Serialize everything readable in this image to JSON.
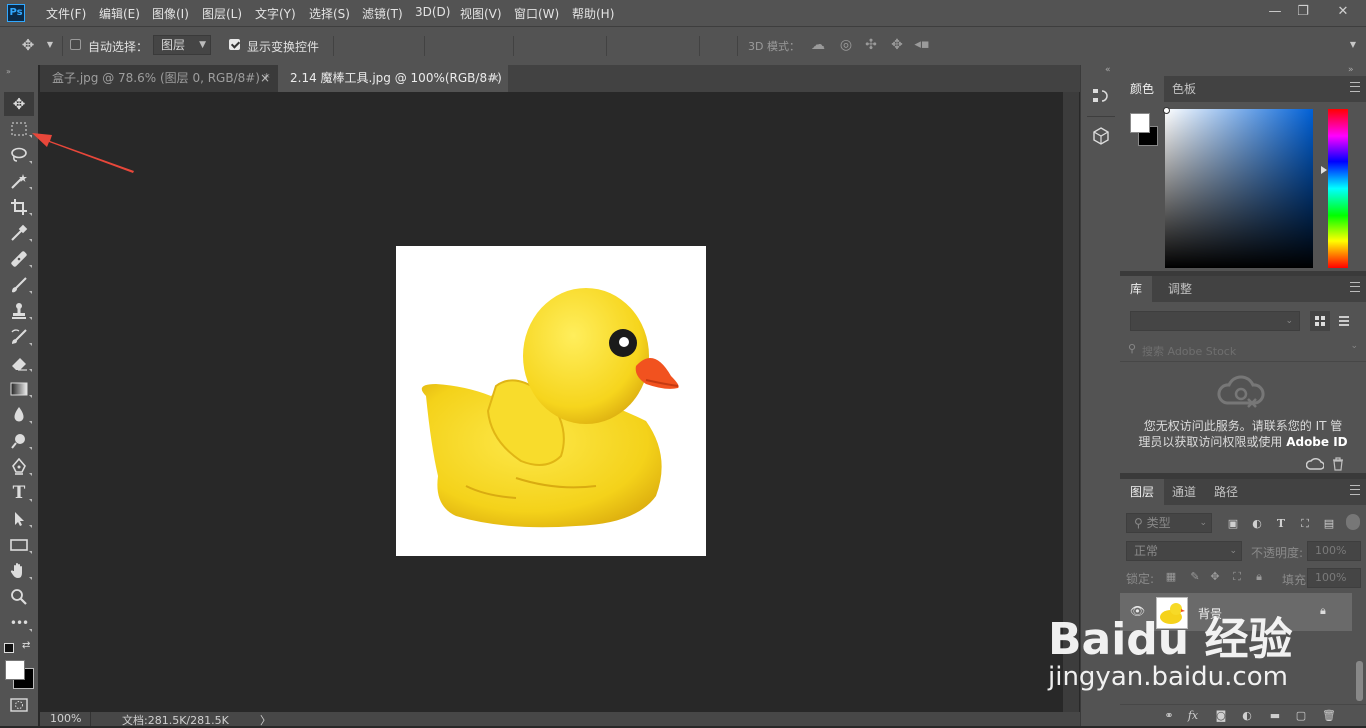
{
  "app": {
    "logo": "Ps"
  },
  "menu": [
    "文件(F)",
    "编辑(E)",
    "图像(I)",
    "图层(L)",
    "文字(Y)",
    "选择(S)",
    "滤镜(T)",
    "3D(D)",
    "视图(V)",
    "窗口(W)",
    "帮助(H)"
  ],
  "window_controls": {
    "minimize": "—",
    "restore": "❐",
    "close": "✕"
  },
  "options": {
    "auto_select_label": "自动选择：",
    "auto_select_target": "图层",
    "show_transform_label": "显示变换控件",
    "mode3d_label": "3D 模式："
  },
  "tabs": [
    {
      "label": "盒子.jpg @ 78.6% (图层 0, RGB/8#) *",
      "close": "×"
    },
    {
      "label": "2.14 魔棒工具.jpg @ 100%(RGB/8#)",
      "close": "×"
    }
  ],
  "tools": [
    "move-icon",
    "marquee-icon",
    "lasso-icon",
    "magic-wand-icon",
    "crop-icon",
    "eyedropper-icon",
    "healing-brush-icon",
    "brush-icon",
    "stamp-icon",
    "history-brush-icon",
    "eraser-icon",
    "gradient-icon",
    "blur-icon",
    "dodge-icon",
    "pen-icon",
    "type-icon",
    "path-select-icon",
    "rectangle-icon",
    "hand-icon",
    "zoom-icon",
    "more-tools-icon"
  ],
  "type_tool_glyph": "T",
  "more_tools_glyph": "•••",
  "status": {
    "zoom": "100%",
    "doc_info": "文档:281.5K/281.5K",
    "arrow": "〉"
  },
  "color_panel": {
    "tabs": [
      "颜色",
      "色板"
    ],
    "foreground": "#ffffff",
    "background": "#000000"
  },
  "library_panel": {
    "tabs": [
      "库",
      "调整"
    ],
    "search_placeholder": "搜索 Adobe Stock",
    "message_line1": "您无权访问此服务。请联系您的 IT 管",
    "message_line2": "理员以获取访问权限或使用",
    "message_brand": "Adobe ID"
  },
  "layers_panel": {
    "tabs": [
      "图层",
      "通道",
      "路径"
    ],
    "filter_kind": "类型",
    "blend_mode": "正常",
    "opacity_label": "不透明度:",
    "opacity_value": "100%",
    "lock_label": "锁定:",
    "fill_label": "填充:",
    "fill_value": "100%",
    "layer_name": "背景",
    "footer_fx": "fx"
  },
  "watermark": {
    "logo": "Baidu 经验",
    "url": "jingyan.baidu.com"
  },
  "colors": {
    "accent_arrow": "#e8473a",
    "ps_blue": "#31a8ff"
  }
}
